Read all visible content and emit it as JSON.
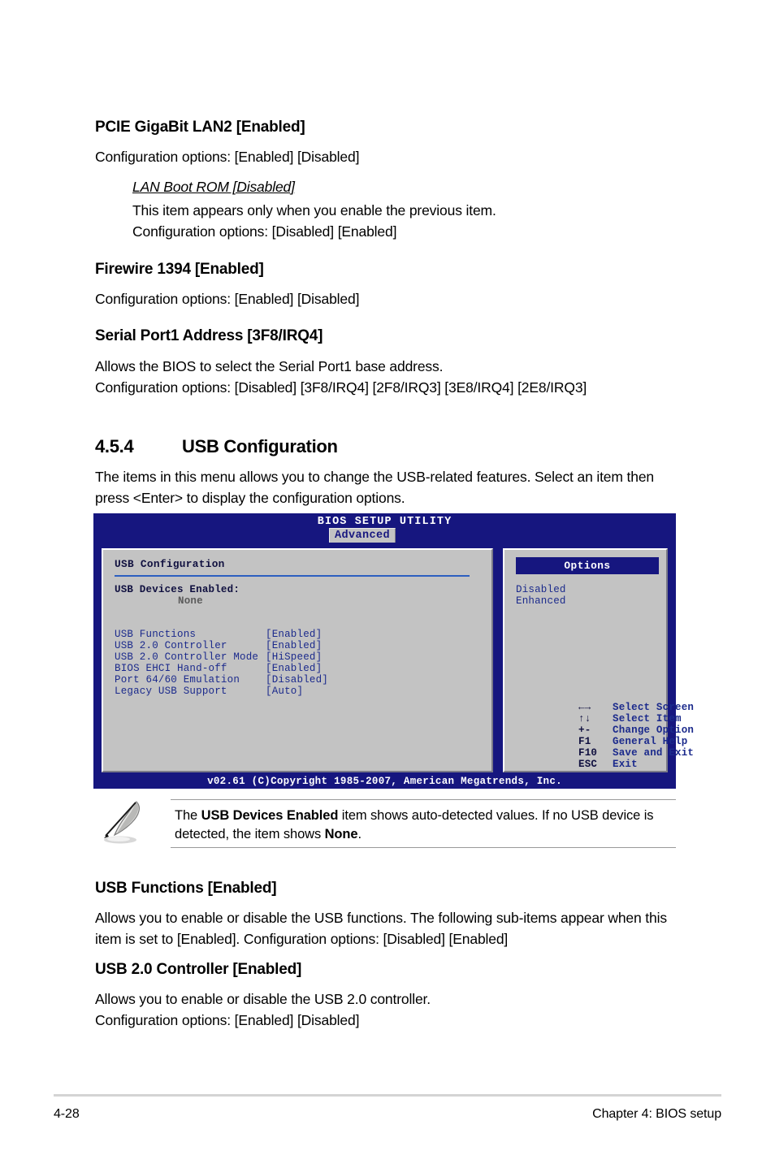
{
  "sections": [
    {
      "heading": "PCIE GigaBit LAN2 [Enabled]",
      "body": "Configuration options: [Enabled] [Disabled]",
      "sub_heading": "LAN Boot ROM [Disabled]",
      "sub_line1": "This item appears only when you enable the previous item.",
      "sub_line2": "Configuration options: [Disabled] [Enabled]"
    },
    {
      "heading": "Firewire 1394 [Enabled]",
      "body": "Configuration options: [Enabled] [Disabled]"
    },
    {
      "heading": "Serial Port1 Address [3F8/IRQ4]",
      "body_line1": "Allows the BIOS to select the Serial Port1 base address.",
      "body_line2": "Configuration options: [Disabled] [3F8/IRQ4] [2F8/IRQ3] [3E8/IRQ4] [2E8/IRQ3]"
    }
  ],
  "section_usb": {
    "number": "4.5.4",
    "title": "USB Configuration",
    "intro": "The items in this menu allows you to change the USB-related features. Select an item then press <Enter> to display the configuration options."
  },
  "bios": {
    "title": "BIOS SETUP UTILITY",
    "tab": "Advanced",
    "panel_heading": "USB Configuration",
    "devices_label": "USB Devices Enabled:",
    "devices_value": "None",
    "items": [
      {
        "label": "USB Functions",
        "value": "[Enabled]"
      },
      {
        "label": "USB 2.0 Controller",
        "value": "[Enabled]"
      },
      {
        "label": "USB 2.0 Controller Mode",
        "value": "[HiSpeed]"
      },
      {
        "label": "BIOS EHCI Hand-off",
        "value": "[Enabled]"
      },
      {
        "label": "Port 64/60 Emulation",
        "value": "[Disabled]"
      },
      {
        "label": "Legacy USB Support",
        "value": "[Auto]"
      }
    ],
    "options_header": "Options",
    "options": [
      "Disabled",
      "Enhanced"
    ],
    "legend": [
      {
        "key": "←→",
        "label": "Select Screen"
      },
      {
        "key": "↑↓",
        "label": "Select Item"
      },
      {
        "key": "+-",
        "label": "Change Option"
      },
      {
        "key": "F1",
        "label": "General Help"
      },
      {
        "key": "F10",
        "label": "Save and Exit"
      },
      {
        "key": "ESC",
        "label": "Exit"
      }
    ],
    "copyright": "v02.61 (C)Copyright 1985-2007, American Megatrends, Inc.",
    "colors": {
      "navy": "#16167f",
      "panel_gray": "#c3c3c3",
      "text_blue": "#1b2a8c",
      "rule_blue": "#2d5fc0"
    }
  },
  "note": {
    "text_part1": "The ",
    "bold1": "USB Devices Enabled",
    "text_part2": " item shows auto-detected values. If no USB device is detected, the item shows ",
    "bold2": "None",
    "text_part3": "."
  },
  "bottom_sections": [
    {
      "heading": "USB Functions [Enabled]",
      "body": "Allows you to enable or disable the USB functions. The following sub-items appear when this item is set to [Enabled]. Configuration options: [Disabled] [Enabled]"
    },
    {
      "heading": "USB 2.0 Controller [Enabled]",
      "body_line1": "Allows you to enable or disable the USB 2.0 controller.",
      "body_line2": "Configuration options: [Enabled] [Disabled]"
    }
  ],
  "footer": {
    "page_number": "4-28",
    "chapter": "Chapter 4: BIOS setup"
  }
}
